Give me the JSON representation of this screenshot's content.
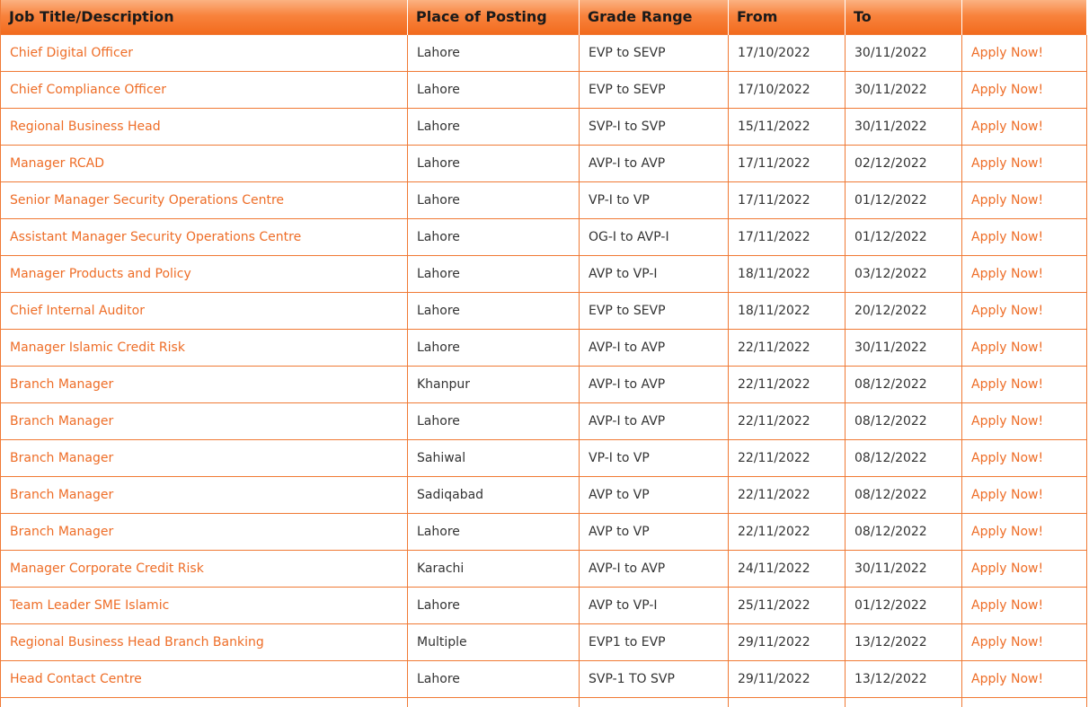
{
  "columns": {
    "title": "Job Title/Description",
    "place": "Place of Posting",
    "grade": "Grade Range",
    "from": "From",
    "to": "To",
    "action": ""
  },
  "apply_label": "Apply Now!",
  "colors": {
    "accent": "#ee6d27",
    "border": "#f07a35",
    "header_gradient_top": "#fbb282",
    "header_gradient_bottom": "#f26b1e"
  },
  "jobs": [
    {
      "title": "Chief Digital Officer",
      "place": "Lahore",
      "grade": "EVP to SEVP",
      "from": "17/10/2022",
      "to": "30/11/2022"
    },
    {
      "title": "Chief Compliance Officer",
      "place": "Lahore",
      "grade": "EVP to SEVP",
      "from": "17/10/2022",
      "to": "30/11/2022"
    },
    {
      "title": "Regional Business Head",
      "place": "Lahore",
      "grade": "SVP-I to SVP",
      "from": "15/11/2022",
      "to": "30/11/2022"
    },
    {
      "title": "Manager RCAD",
      "place": "Lahore",
      "grade": "AVP-I to AVP",
      "from": "17/11/2022",
      "to": "02/12/2022"
    },
    {
      "title": "Senior Manager Security Operations Centre",
      "place": "Lahore",
      "grade": "VP-I to VP",
      "from": "17/11/2022",
      "to": "01/12/2022"
    },
    {
      "title": "Assistant Manager Security Operations Centre",
      "place": "Lahore",
      "grade": "OG-I to AVP-I",
      "from": "17/11/2022",
      "to": "01/12/2022"
    },
    {
      "title": "Manager Products and Policy",
      "place": "Lahore",
      "grade": "AVP to VP-I",
      "from": "18/11/2022",
      "to": "03/12/2022"
    },
    {
      "title": "Chief Internal Auditor",
      "place": "Lahore",
      "grade": "EVP to SEVP",
      "from": "18/11/2022",
      "to": "20/12/2022"
    },
    {
      "title": "Manager Islamic Credit Risk",
      "place": "Lahore",
      "grade": "AVP-I to AVP",
      "from": "22/11/2022",
      "to": "30/11/2022"
    },
    {
      "title": "Branch Manager",
      "place": "Khanpur",
      "grade": "AVP-I to AVP",
      "from": "22/11/2022",
      "to": "08/12/2022"
    },
    {
      "title": "Branch Manager",
      "place": "Lahore",
      "grade": "AVP-I to AVP",
      "from": "22/11/2022",
      "to": "08/12/2022"
    },
    {
      "title": "Branch Manager",
      "place": "Sahiwal",
      "grade": "VP-I to VP",
      "from": "22/11/2022",
      "to": "08/12/2022"
    },
    {
      "title": "Branch Manager",
      "place": "Sadiqabad",
      "grade": "AVP to VP",
      "from": "22/11/2022",
      "to": "08/12/2022"
    },
    {
      "title": "Branch Manager",
      "place": "Lahore",
      "grade": "AVP to VP",
      "from": "22/11/2022",
      "to": "08/12/2022"
    },
    {
      "title": "Manager Corporate Credit Risk",
      "place": "Karachi",
      "grade": "AVP-I to AVP",
      "from": "24/11/2022",
      "to": "30/11/2022"
    },
    {
      "title": "Team Leader SME Islamic",
      "place": "Lahore",
      "grade": "AVP to VP-I",
      "from": "25/11/2022",
      "to": "01/12/2022"
    },
    {
      "title": "Regional Business Head Branch Banking",
      "place": "Multiple",
      "grade": "EVP1 to EVP",
      "from": "29/11/2022",
      "to": "13/12/2022"
    },
    {
      "title": "Head Contact Centre",
      "place": "Lahore",
      "grade": "SVP-1 TO SVP",
      "from": "29/11/2022",
      "to": "13/12/2022"
    }
  ]
}
